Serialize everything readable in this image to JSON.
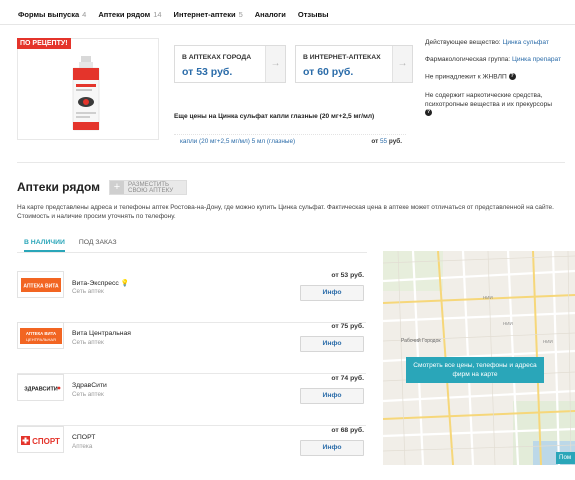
{
  "tabs": [
    {
      "label": "Формы выпуска",
      "count": "4"
    },
    {
      "label": "Аптеки рядом",
      "count": "14"
    },
    {
      "label": "Интернет-аптеки",
      "count": "5"
    },
    {
      "label": "Аналоги",
      "count": ""
    },
    {
      "label": "Отзывы",
      "count": ""
    }
  ],
  "product": {
    "rx_badge": "ПО РЕЦЕПТУ!"
  },
  "price_cards": [
    {
      "title": "В АПТЕКАХ ГОРОДА",
      "price": "от 53 руб."
    },
    {
      "title": "В ИНТЕРНЕТ-АПТЕКАХ",
      "price": "от 60 руб."
    }
  ],
  "more_prices": {
    "title": "Еще цены на Цинка сульфат капли глазные (20 мг+2,5 мг/мл)",
    "rows": [
      {
        "name": "капли (20 мг+2,5 мг/мл) 5 мл (глазные)",
        "price_prefix": "от",
        "price": "55",
        "price_suffix": "руб."
      }
    ]
  },
  "info": {
    "active_label": "Действующее вещество:",
    "active_value": "Цинка сульфат",
    "pharm_label": "Фармакологическая группа:",
    "pharm_value": "Цинка препарат",
    "jnvlp": "Не принадлежит к ЖНВЛП",
    "narcotic": "Не содержит наркотические средства, психотропные вещества и их прекурсоры"
  },
  "pharmacies": {
    "title": "Аптеки рядом",
    "add_button": "РАЗМЕСТИТЬ СВОЮ АПТЕКУ",
    "description": "На карте представлены адреса и телефоны аптек Ростова-на-Дону, где можно купить Цинка сульфат. Фактическая цена в аптеке может отличаться от представленной на сайте. Стоимость и наличие просим уточнять по телефону.",
    "subtabs": [
      "В НАЛИЧИИ",
      "ПОД ЗАКАЗ"
    ],
    "items": [
      {
        "name": "Вита-Экспресс",
        "type": "Сеть аптек",
        "price": "от 53 руб.",
        "button": "Инфо",
        "logo_text": "АПТЕКА ВИТА"
      },
      {
        "name": "Вита Центральная",
        "type": "Сеть аптек",
        "price": "от 75 руб.",
        "button": "Инфо",
        "logo_text": "АПТЕКА ВИТА ЦЕНТРАЛЬНАЯ"
      },
      {
        "name": "ЗдравСити",
        "type": "Сеть аптек",
        "price": "от 74 руб.",
        "button": "Инфо",
        "logo_text": "ЗДРАВСИТИ.РУ"
      },
      {
        "name": "СПОРТ",
        "type": "Аптека",
        "price": "от 68 руб.",
        "button": "Инфо",
        "logo_text": "СПОРТ"
      }
    ]
  },
  "map": {
    "button": "Смотреть все цены, телефоны и адреса фирм на карте",
    "button2": "Пом",
    "labels": [
      "Рабочий Городок",
      "НИИ",
      "НИИ",
      "НИИ"
    ]
  },
  "colors": {
    "accent": "#2aa6b9",
    "link": "#2b6ca9",
    "rx_red": "#e4342b",
    "logo_orange": "#f26522"
  }
}
